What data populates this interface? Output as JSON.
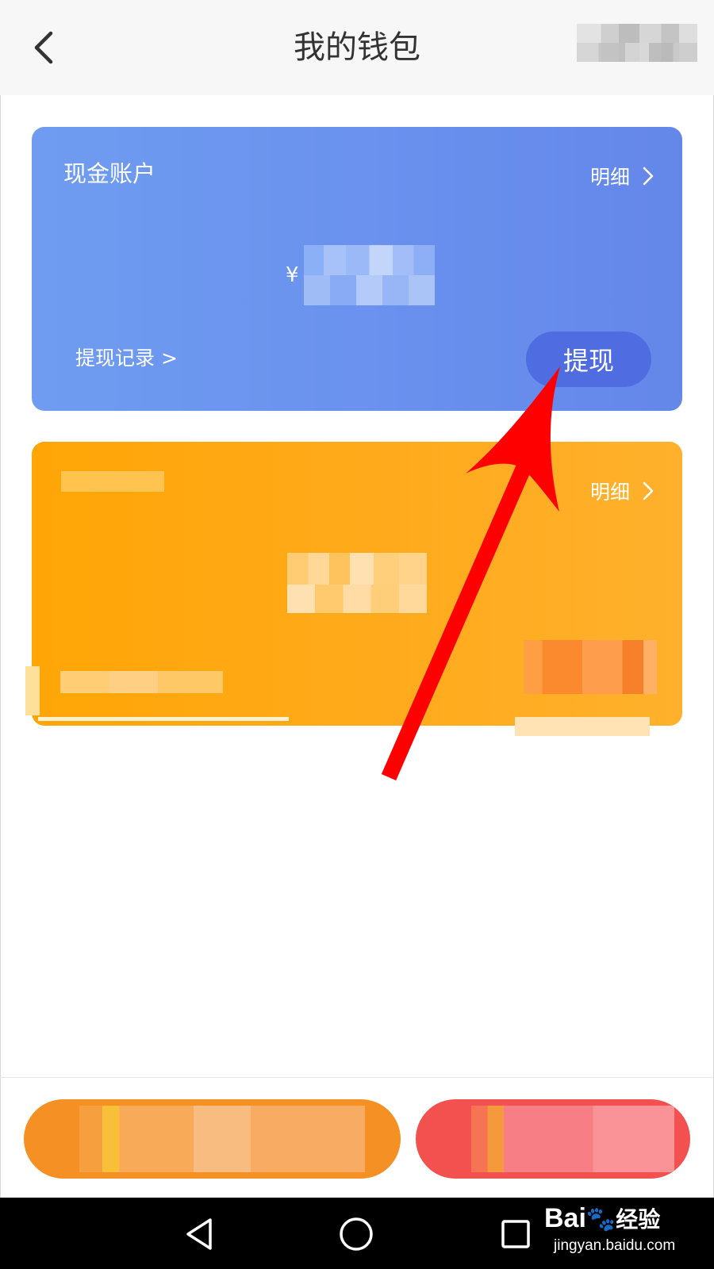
{
  "header": {
    "title": "我的钱包",
    "back_icon": "chevron-left-icon"
  },
  "cash_account": {
    "title": "现金账户",
    "detail_label": "明细",
    "currency_symbol": "¥",
    "withdraw_record_label": "提现记录 >",
    "withdraw_button_label": "提现",
    "withdraw_button_color": "#4f6ce0"
  },
  "second_account": {
    "detail_label": "明细"
  },
  "watermark": {
    "brand": "Bai",
    "brand_suffix": "经验",
    "url": "jingyan.baidu.com"
  },
  "colors": {
    "cash_card": "#6a92ee",
    "orange_card": "#ffab1e",
    "pill_left": "#f49024",
    "pill_right": "#f2514f",
    "annotation_arrow": "#ff0000"
  }
}
